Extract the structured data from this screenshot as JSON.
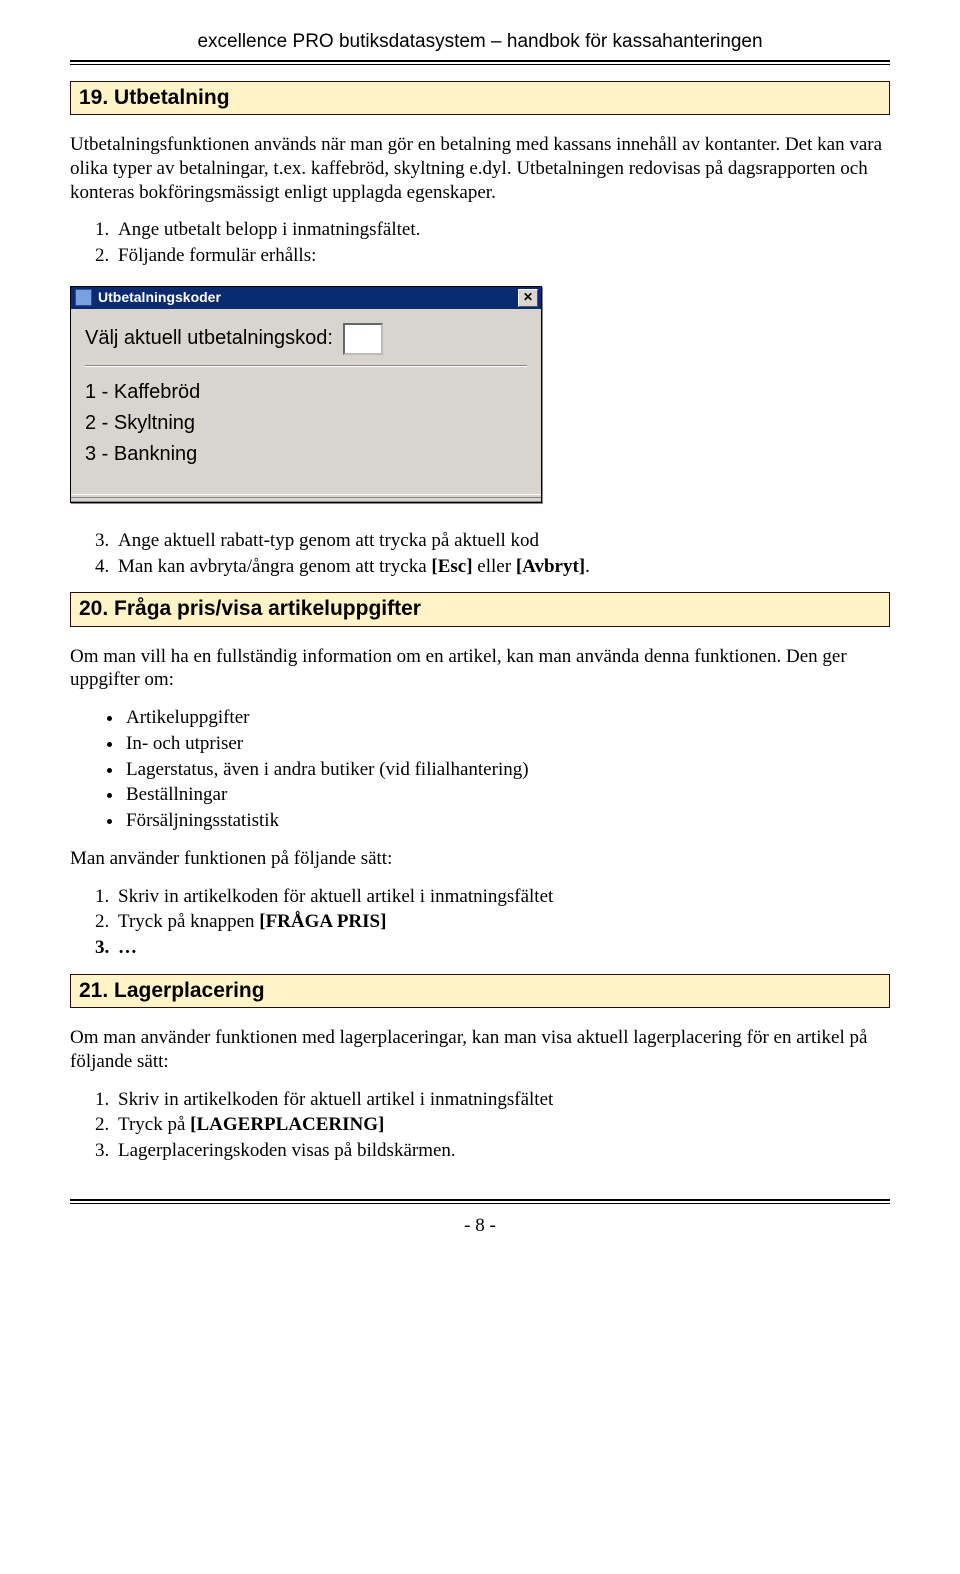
{
  "header": {
    "text": "excellence PRO butiksdatasystem – handbok för kassahanteringen"
  },
  "sections": {
    "s19": {
      "title": "19. Utbetalning",
      "intro": "Utbetalningsfunktionen används när man gör en betalning med kassans innehåll av kontanter. Det kan vara olika typer av betalningar, t.ex. kaffebröd, skyltning e.dyl. Utbetalningen redovisas på dagsrapporten och konteras bokföringsmässigt enligt upplagda egenskaper.",
      "steps12": {
        "1": "Ange utbetalt belopp i inmatningsfältet.",
        "2": "Följande formulär erhålls:"
      },
      "steps34": {
        "3": "Ange aktuell rabatt-typ genom att trycka på aktuell kod",
        "4_pre": "Man kan avbryta/ångra genom att trycka ",
        "4_b1": "[Esc]",
        "4_mid": " eller ",
        "4_b2": "[Avbryt]",
        "4_post": "."
      }
    },
    "s20": {
      "title": "20. Fråga pris/visa artikeluppgifter",
      "intro": "Om man vill ha en fullständig information om en artikel, kan man använda denna funktionen. Den ger uppgifter om:",
      "bullets": {
        "0": "Artikeluppgifter",
        "1": "In- och utpriser",
        "2": "Lagerstatus, även i andra butiker (vid filialhantering)",
        "3": "Beställningar",
        "4": "Försäljningsstatistik"
      },
      "usage_intro": "Man använder funktionen på följande sätt:",
      "steps": {
        "1": "Skriv in artikelkoden för aktuell artikel i inmatningsfältet",
        "2_pre": "Tryck på knappen ",
        "2_b": "[FRÅGA PRIS]",
        "3": "…"
      }
    },
    "s21": {
      "title": "21. Lagerplacering",
      "intro": "Om man använder funktionen med lagerplaceringar, kan man visa aktuell lagerplacering för en artikel på följande sätt:",
      "steps": {
        "1": "Skriv in artikelkoden för aktuell artikel i inmatningsfältet",
        "2_pre": "Tryck på ",
        "2_b": "[LAGERPLACERING]",
        "3": "Lagerplaceringskoden visas på bildskärmen."
      }
    }
  },
  "dialog": {
    "title": "Utbetalningskoder",
    "prompt": "Välj aktuell utbetalningskod:",
    "codes": {
      "0": "1 - Kaffebröd",
      "1": "2 - Skyltning",
      "2": "3 - Bankning"
    },
    "close_glyph": "✕"
  },
  "footer": {
    "page": "- 8 -"
  }
}
